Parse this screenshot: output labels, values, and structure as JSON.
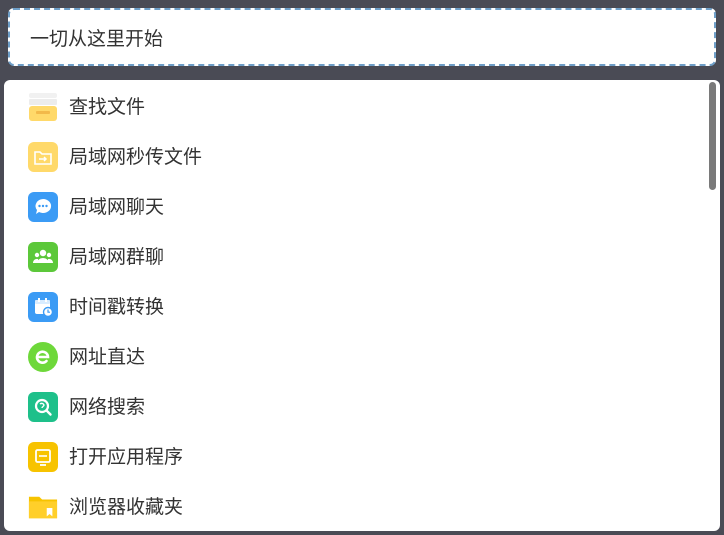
{
  "search": {
    "text": "一切从这里开始"
  },
  "items": [
    {
      "label": "查找文件",
      "icon": "file-cabinet-icon"
    },
    {
      "label": "局域网秒传文件",
      "icon": "folder-transfer-icon"
    },
    {
      "label": "局域网聊天",
      "icon": "chat-bubble-icon"
    },
    {
      "label": "局域网群聊",
      "icon": "group-users-icon"
    },
    {
      "label": "时间戳转换",
      "icon": "calendar-clock-icon"
    },
    {
      "label": "网址直达",
      "icon": "browser-e-icon"
    },
    {
      "label": "网络搜索",
      "icon": "web-search-icon"
    },
    {
      "label": "打开应用程序",
      "icon": "app-window-icon"
    },
    {
      "label": "浏览器收藏夹",
      "icon": "bookmark-folder-icon"
    }
  ],
  "colors": {
    "accent_border": "#6f9fc8",
    "folder_yellow": "#ffd96a",
    "chat_blue": "#3b9bf5",
    "group_green": "#5cc83a",
    "calendar_blue": "#3b9bf5",
    "browser_green": "#6ed83a",
    "search_teal": "#1ec08a",
    "app_yellow": "#f7c300"
  }
}
